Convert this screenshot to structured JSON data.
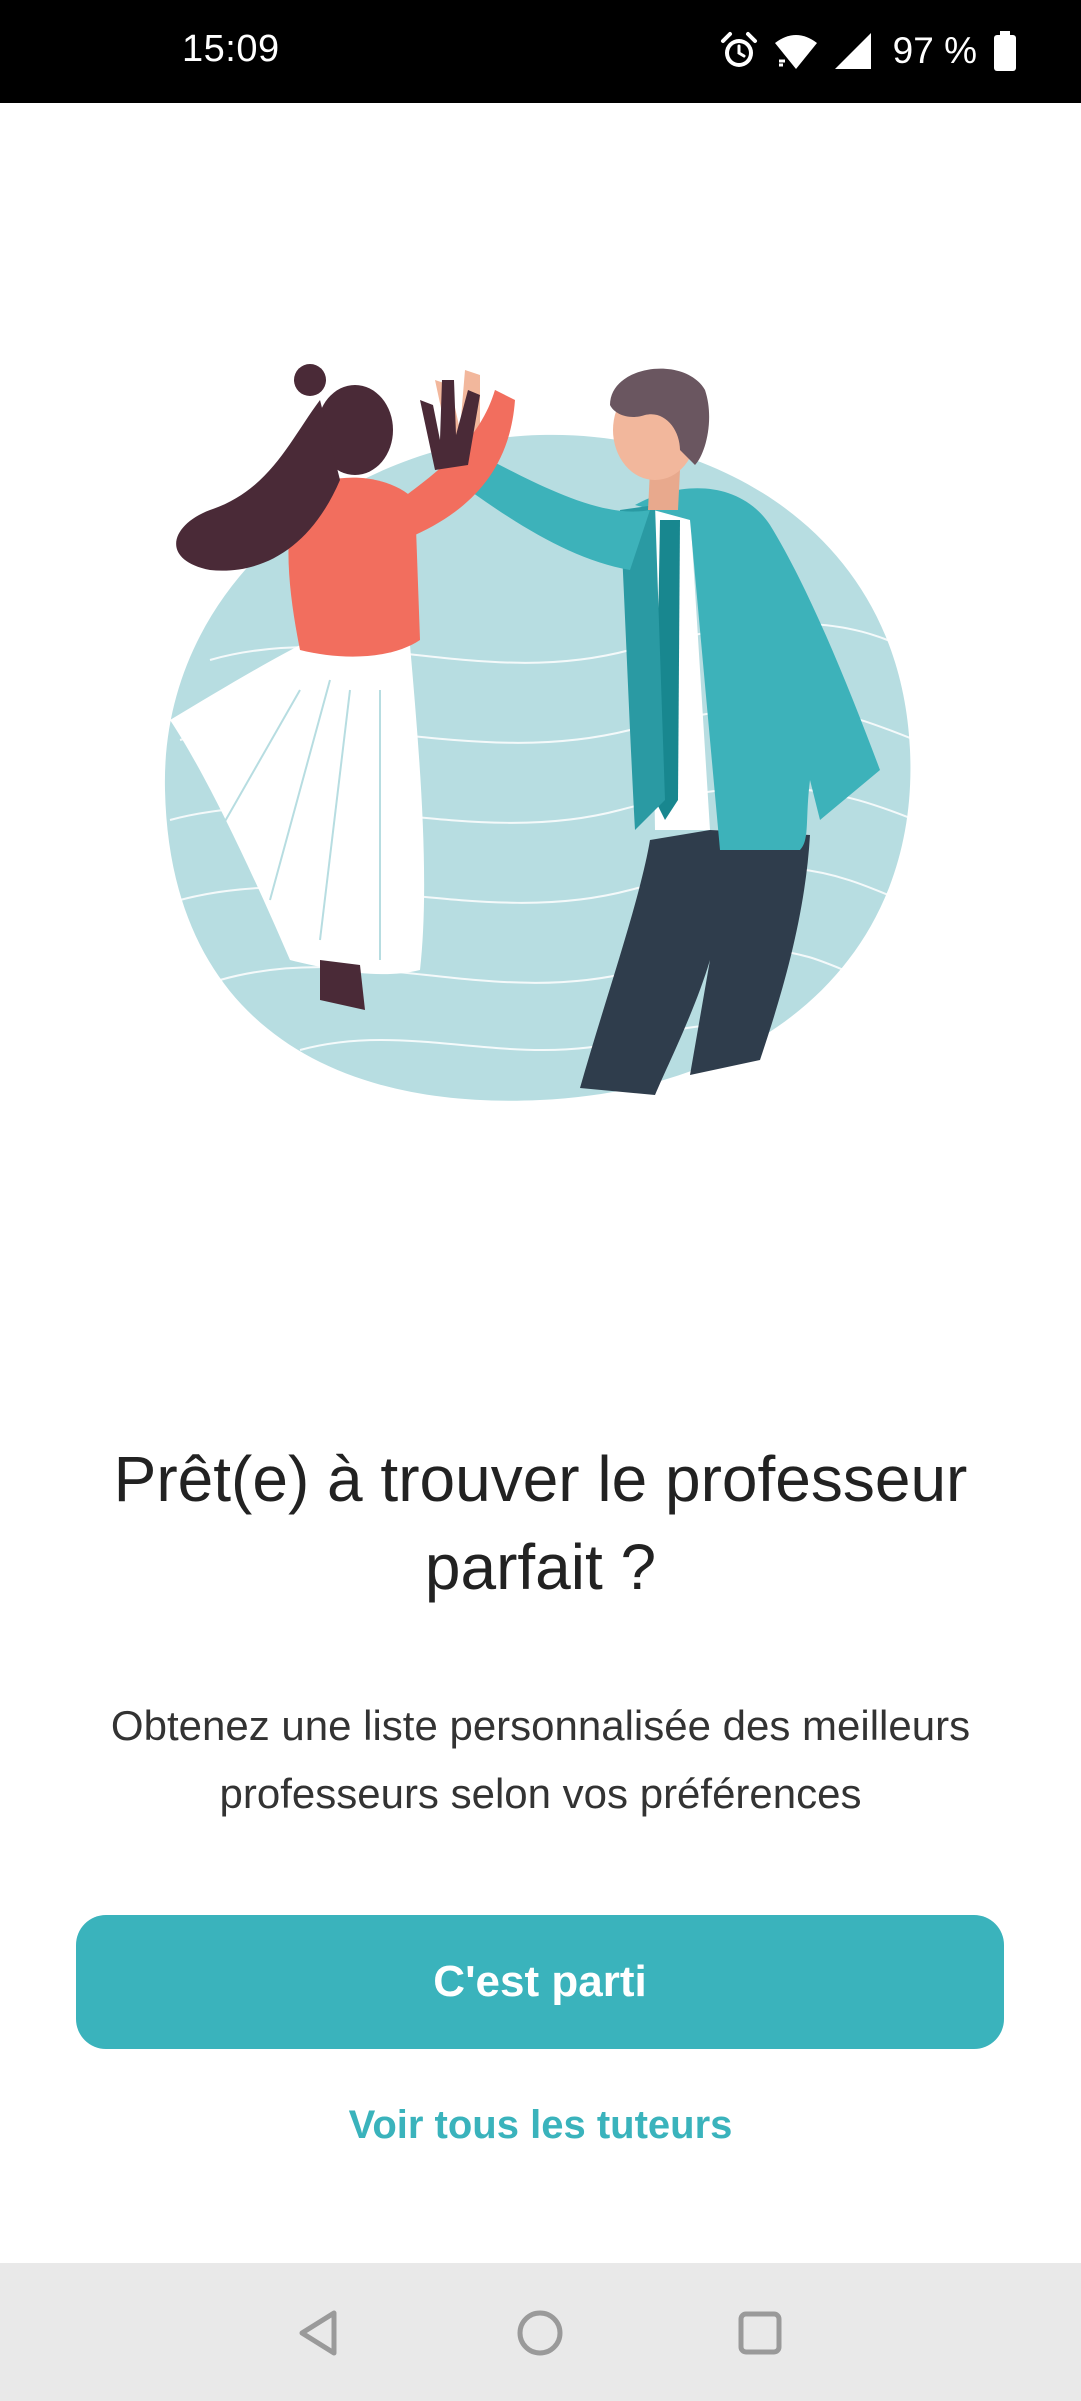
{
  "status_bar": {
    "time": "15:09",
    "battery": "97 %",
    "icons": [
      "alarm-icon",
      "wifi-icon",
      "signal-icon",
      "battery-icon"
    ]
  },
  "illustration": {
    "name": "two people giving a high five",
    "colors": {
      "backdrop": "#b7dde1",
      "jacket": "#3db2ba",
      "pants": "#2f3d4c",
      "top": "#f26e5e",
      "skirt": "#ffffff",
      "hair_woman": "#4a2a37",
      "hair_man": "#6a5660"
    }
  },
  "content": {
    "title": "Prêt(e) à trouver le professeur parfait ?",
    "subtitle": "Obtenez une liste personnalisée des meilleurs professeurs selon vos préférences"
  },
  "actions": {
    "primary_label": "C'est parti",
    "secondary_label": "Voir tous les tuteurs"
  },
  "nav_bar": {
    "buttons": [
      "back-icon",
      "home-icon",
      "recents-icon"
    ]
  },
  "colors": {
    "accent": "#3ab3bc",
    "title_text": "#222222",
    "body_text": "#333333",
    "nav_background": "#e9e9e9"
  }
}
